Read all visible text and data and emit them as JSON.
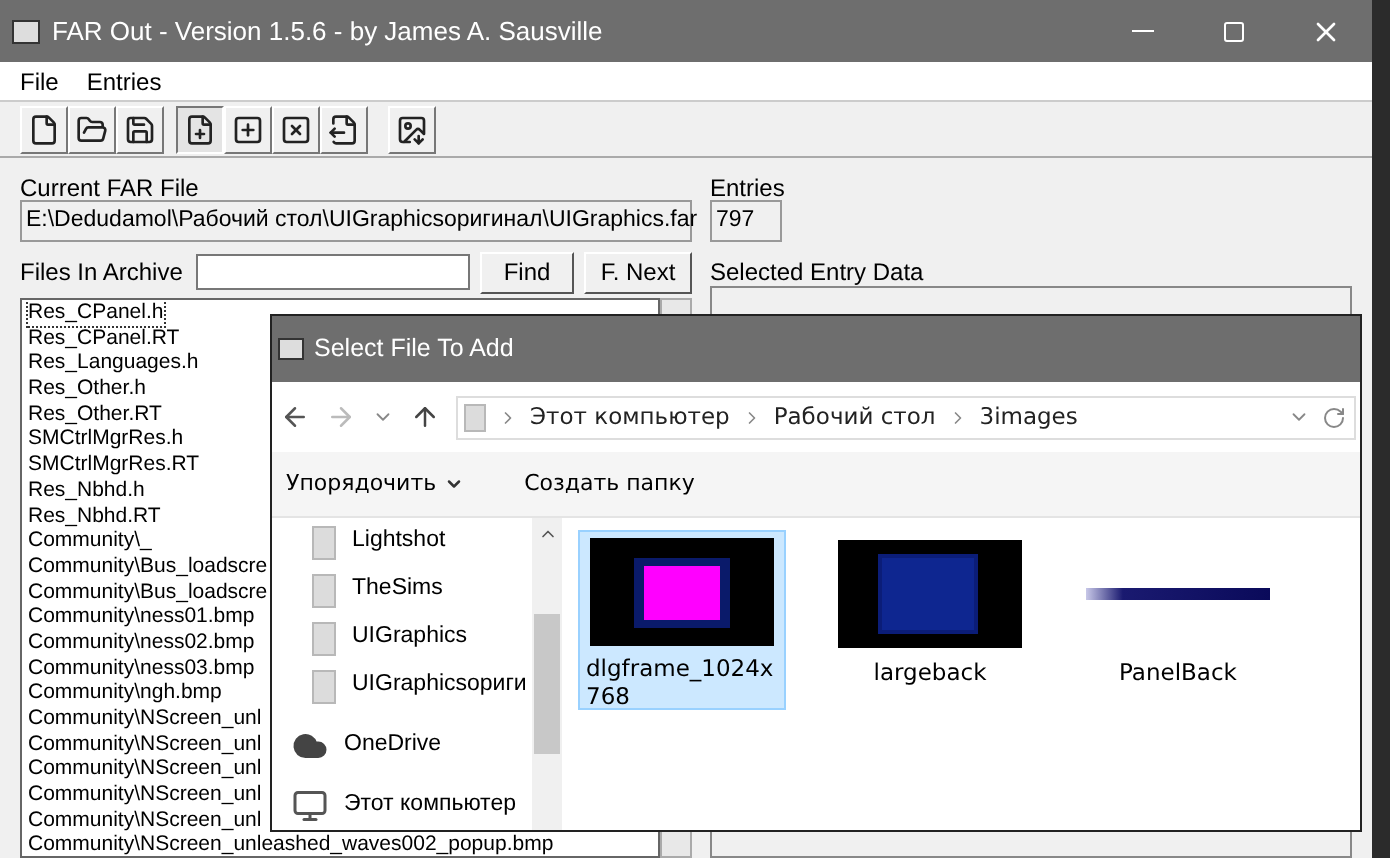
{
  "window": {
    "title": "FAR Out - Version 1.5.6 - by James A. Sausville"
  },
  "menu": [
    "File",
    "Entries"
  ],
  "current_far_file": {
    "label": "Current FAR File",
    "value": "E:\\Dedudamol\\Рабочий стол\\UIGraphicsоригинал\\UIGraphics.far"
  },
  "entries": {
    "label": "Entries",
    "value": "797"
  },
  "files_in_archive": {
    "label": "Files In Archive",
    "find": "Find",
    "find_next": "F. Next"
  },
  "selected_entry_data": {
    "label": "Selected Entry Data"
  },
  "file_list": [
    {
      "name": "Res_CPanel.h",
      "selected": true
    },
    {
      "name": "Res_CPanel.RT",
      "selected": false
    },
    {
      "name": "Res_Languages.h",
      "selected": false
    },
    {
      "name": "Res_Other.h",
      "selected": false
    },
    {
      "name": "Res_Other.RT",
      "selected": false
    },
    {
      "name": "SMCtrlMgrRes.h",
      "selected": false
    },
    {
      "name": "SMCtrlMgrRes.RT",
      "selected": false
    },
    {
      "name": "Res_Nbhd.h",
      "selected": false
    },
    {
      "name": "Res_Nbhd.RT",
      "selected": false
    },
    {
      "name": "Community\\_",
      "selected": false
    },
    {
      "name": "Community\\Bus_loadscre",
      "selected": false
    },
    {
      "name": "Community\\Bus_loadscre",
      "selected": false
    },
    {
      "name": "Community\\ness01.bmp",
      "selected": false
    },
    {
      "name": "Community\\ness02.bmp",
      "selected": false
    },
    {
      "name": "Community\\ness03.bmp",
      "selected": false
    },
    {
      "name": "Community\\ngh.bmp",
      "selected": false
    },
    {
      "name": "Community\\NScreen_unl",
      "selected": false
    },
    {
      "name": "Community\\NScreen_unl",
      "selected": false
    },
    {
      "name": "Community\\NScreen_unl",
      "selected": false
    },
    {
      "name": "Community\\NScreen_unl",
      "selected": false
    },
    {
      "name": "Community\\NScreen_unl",
      "selected": false
    },
    {
      "name": "Community\\NScreen_unleashed_waves002_popup.bmp",
      "selected": false
    }
  ],
  "dialog": {
    "title": "Select File To Add",
    "breadcrumb": [
      "Этот компьютер",
      "Рабочий стол",
      "3images"
    ],
    "toolbar": [
      "Упорядочить",
      "Создать папку"
    ],
    "nav": [
      {
        "name": "Lightshot",
        "kind": "folder"
      },
      {
        "name": "TheSims",
        "kind": "folder"
      },
      {
        "name": "UIGraphics",
        "kind": "folder"
      },
      {
        "name": "UIGraphicsориги",
        "kind": "folder"
      },
      {
        "name": "OneDrive",
        "kind": "cloud"
      },
      {
        "name": "Этот компьютер",
        "kind": "computer"
      }
    ],
    "files": [
      {
        "name": "dlgframe_1024x768",
        "selected": true,
        "kind": "frame"
      },
      {
        "name": "largeback",
        "selected": false,
        "kind": "back"
      },
      {
        "name": "PanelBack",
        "selected": false,
        "kind": "bar"
      }
    ]
  }
}
